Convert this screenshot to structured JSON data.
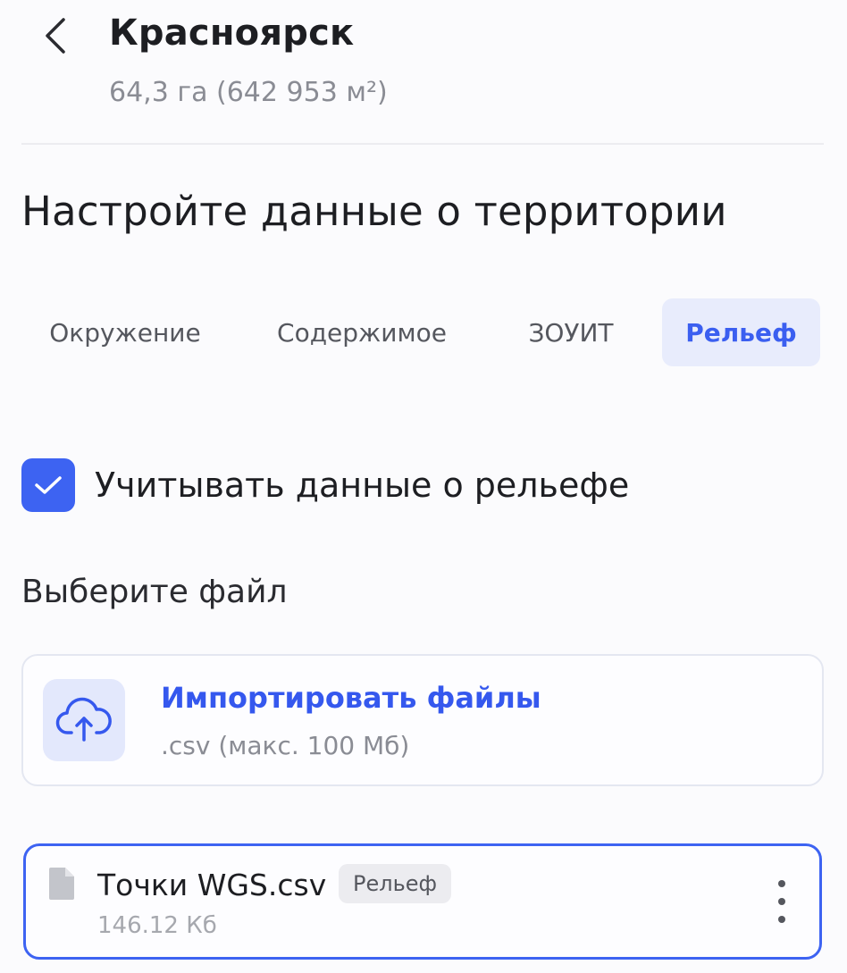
{
  "header": {
    "back_icon": "chevron-left-icon",
    "title": "Красноярск",
    "subtitle": "64,3 га (642 953 м²)"
  },
  "section": {
    "title": "Настройте данные о территории"
  },
  "tabs": [
    {
      "label": "Окружение",
      "active": false
    },
    {
      "label": "Содержимое",
      "active": false
    },
    {
      "label": "ЗОУИТ",
      "active": false
    },
    {
      "label": "Рельеф",
      "active": true
    }
  ],
  "relief": {
    "checkbox_checked": true,
    "checkbox_label": "Учитывать данные о рельефе",
    "choose_file_label": "Выберите файл"
  },
  "import": {
    "icon": "cloud-upload-icon",
    "title": "Импортировать файлы",
    "hint": ".csv (макс. 100 Мб)"
  },
  "file": {
    "icon": "file-icon",
    "name": "Точки WGS.csv",
    "tag": "Рельеф",
    "size": "146.12 Кб",
    "menu_icon": "more-vertical-icon"
  },
  "colors": {
    "accent": "#3d63f2",
    "accent_light": "#e8ecfc",
    "text_primary": "#1d1e22",
    "text_secondary": "#8a8c94"
  }
}
